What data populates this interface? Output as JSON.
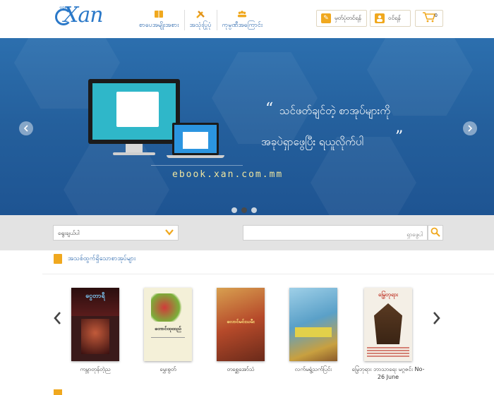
{
  "brand": {
    "logo_text": "Xan",
    "logo_tag": "ဈေး"
  },
  "nav": [
    {
      "label": "စာပေအမျိုးအစား",
      "icon": "book-icon"
    },
    {
      "label": "အသုံးပြုပုံ",
      "icon": "tools-icon"
    },
    {
      "label": "ကုမ္ပဏီအကြောင်း",
      "icon": "people-icon"
    }
  ],
  "header_actions": {
    "register_label": "မှတ်ပုံတင်ရန်",
    "login_label": "ဝင်ရန်",
    "cart_count": "0"
  },
  "banner": {
    "url_text": "ebook.xan.com.mm",
    "tagline_line1": "သင်ဖတ်ချင်တဲ့ စာအုပ်များကို",
    "tagline_line2": "အခုပဲရှာဖွေပြီး ရယူလိုက်ပါ",
    "open_quote": "“",
    "close_quote": "”",
    "slide_count": 3,
    "active_slide": 1
  },
  "search": {
    "category_select_value": "ရွေးချယ်ပါ",
    "search_placeholder": "ရှာဖွေပါ"
  },
  "section": {
    "title": "အသစ်ထွက်ရှိသောစာအုပ်များ"
  },
  "books": [
    {
      "title": "ကမ္ဘာတုန်တဲ့ည",
      "cover_text": "ငွေတာရီ",
      "cover_bg": "#3a1a1a"
    },
    {
      "title": "မွှေးစွတ်",
      "cover_text": "တောင်ထုထည်",
      "cover_bg": "#f4f0d8"
    },
    {
      "title": "တစ္ဆေအော်သံ",
      "cover_text": "လောင်မင်းသမီး",
      "cover_bg": "#b64a2a"
    },
    {
      "title": "လက်မရွံ့သက်ပြင်း",
      "cover_text": "",
      "cover_bg": "#5aa0c8"
    },
    {
      "title": "မြွေဘုရား ဘာသာရေး မဂ္ဂဇင်း No-26 June",
      "cover_text": "မြွေဘုရား",
      "cover_bg": "#f4efe6"
    }
  ],
  "colors": {
    "accent": "#f0a81e",
    "link_blue": "#1f5fa8",
    "banner_blue": "#245f9c"
  }
}
